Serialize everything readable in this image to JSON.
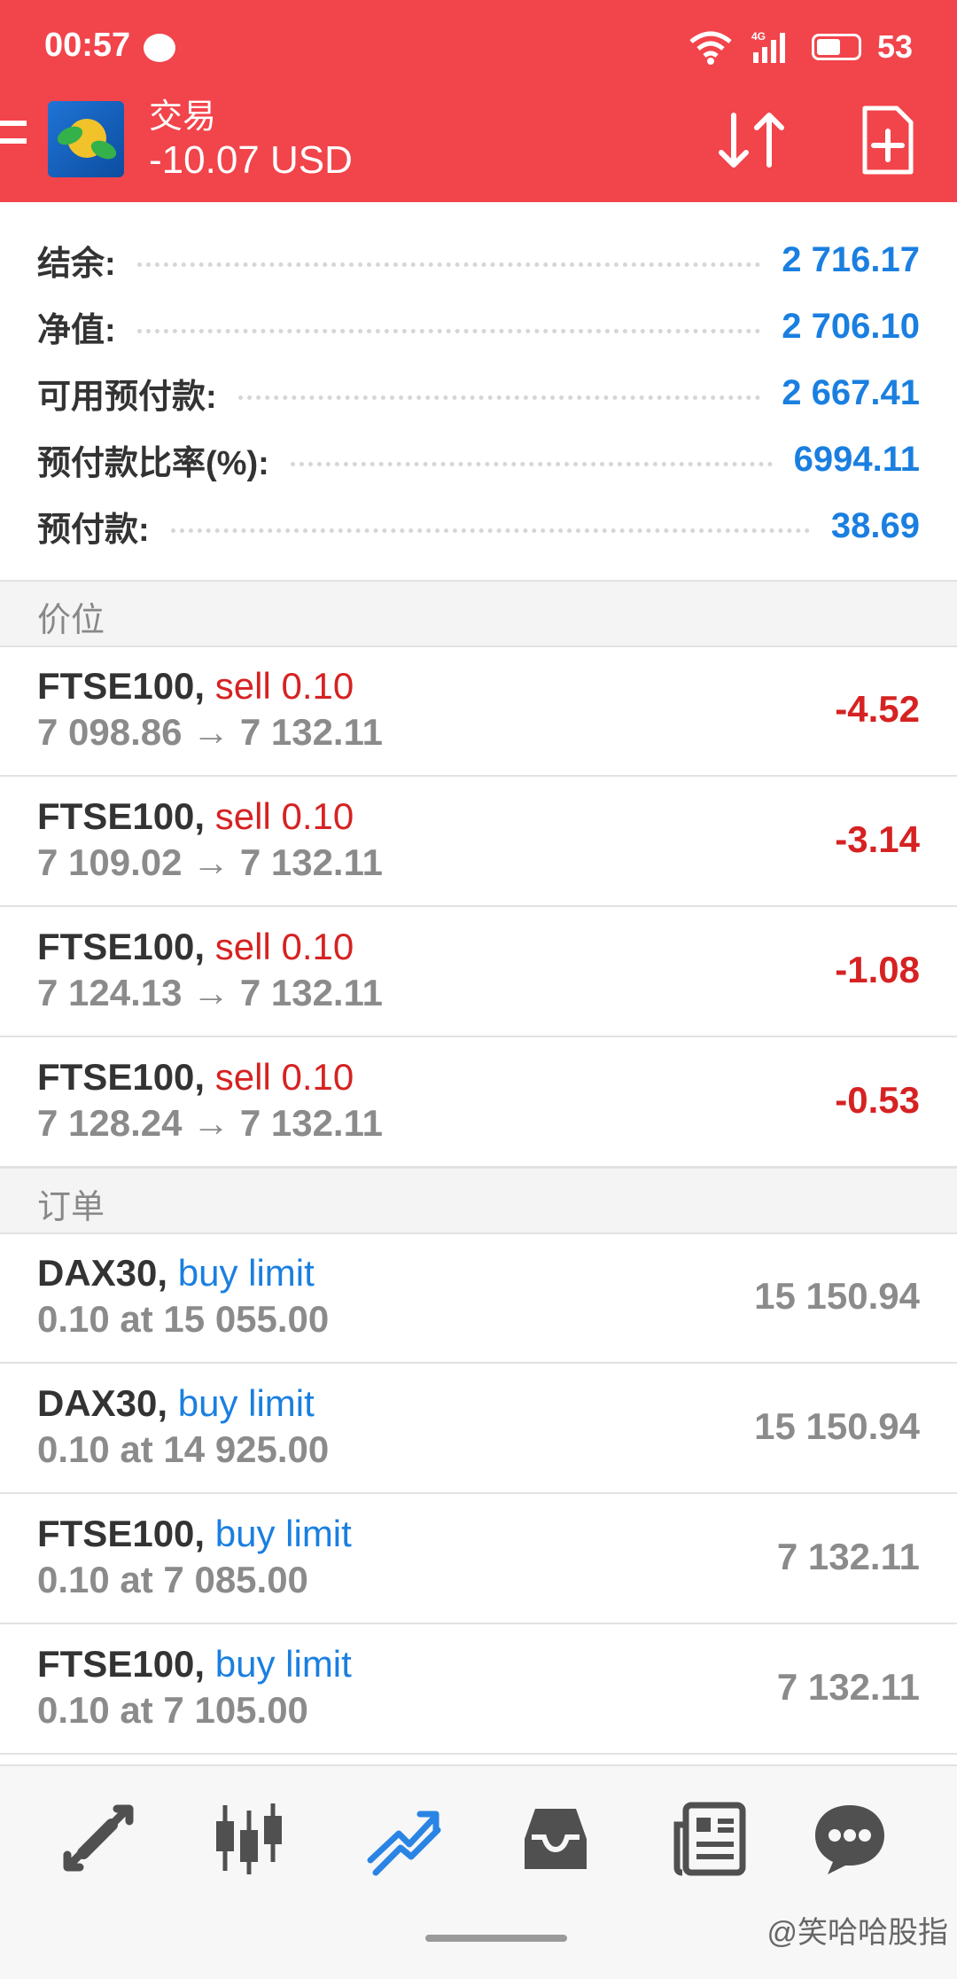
{
  "status_bar": {
    "time": "00:57",
    "network": "4G",
    "battery": "53"
  },
  "header": {
    "title": "交易",
    "balance_line": "-10.07 USD"
  },
  "account": [
    {
      "label": "结余:",
      "value": "2 716.17"
    },
    {
      "label": "净值:",
      "value": "2 706.10"
    },
    {
      "label": "可用预付款:",
      "value": "2 667.41"
    },
    {
      "label": "预付款比率(%):",
      "value": "6994.11"
    },
    {
      "label": "预付款:",
      "value": "38.69"
    }
  ],
  "positions": {
    "title": "价位",
    "items": [
      {
        "symbol": "FTSE100,",
        "kind": "sell 0.10",
        "detail": "7 098.86 → 7 132.11",
        "profit": "-4.52"
      },
      {
        "symbol": "FTSE100,",
        "kind": "sell 0.10",
        "detail": "7 109.02 → 7 132.11",
        "profit": "-3.14"
      },
      {
        "symbol": "FTSE100,",
        "kind": "sell 0.10",
        "detail": "7 124.13 → 7 132.11",
        "profit": "-1.08"
      },
      {
        "symbol": "FTSE100,",
        "kind": "sell 0.10",
        "detail": "7 128.24 → 7 132.11",
        "profit": "-0.53"
      }
    ]
  },
  "orders": {
    "title": "订单",
    "items": [
      {
        "symbol": "DAX30,",
        "kind": "buy limit",
        "detail": "0.10 at 15 055.00",
        "price": "15 150.94"
      },
      {
        "symbol": "DAX30,",
        "kind": "buy limit",
        "detail": "0.10 at 14 925.00",
        "price": "15 150.94"
      },
      {
        "symbol": "FTSE100,",
        "kind": "buy limit",
        "detail": "0.10 at 7 085.00",
        "price": "7 132.11"
      },
      {
        "symbol": "FTSE100,",
        "kind": "buy limit",
        "detail": "0.10 at 7 105.00",
        "price": "7 132.11"
      }
    ]
  },
  "bottom_nav": {
    "items": [
      "quotes-icon",
      "chart-icon",
      "trade-icon",
      "history-icon",
      "news-icon",
      "chat-icon"
    ],
    "active": "trade-icon"
  },
  "watermark": "@笑哈哈股指",
  "colors": {
    "header": "#f2444b",
    "accent": "#1a7fe0",
    "loss": "#d62222"
  }
}
